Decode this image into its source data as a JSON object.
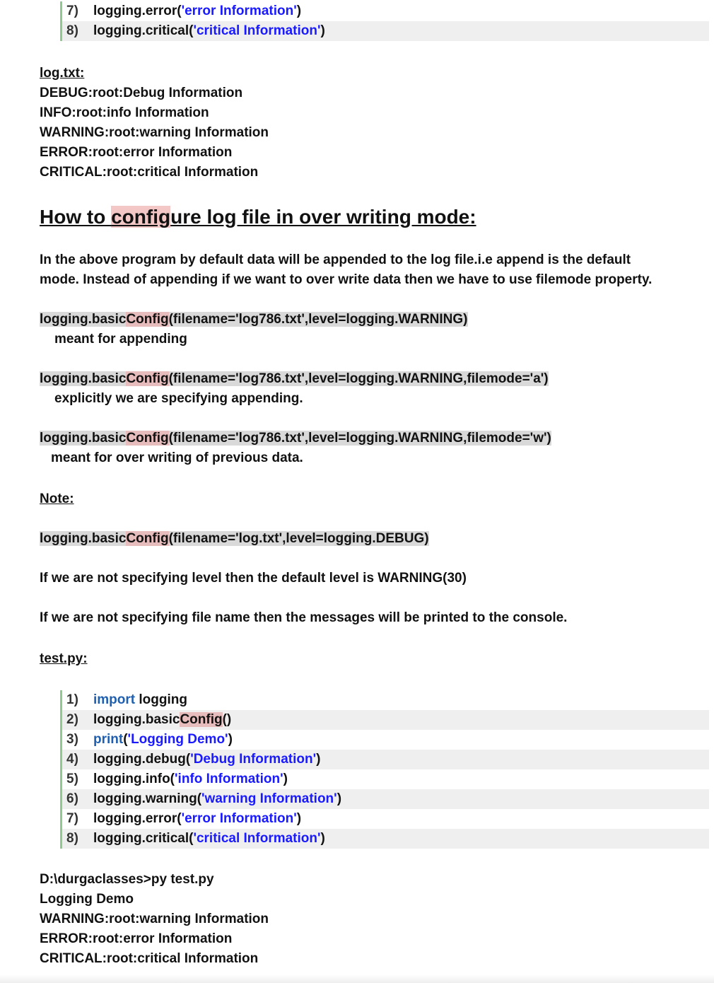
{
  "top_code": [
    {
      "num": "7)",
      "pre": "logging.error(",
      "str": "'error Information'",
      "post": ")"
    },
    {
      "num": "8)",
      "pre": "logging.critical(",
      "str": "'critical Information'",
      "post": ")"
    }
  ],
  "logtxt": {
    "title": "log.txt:",
    "lines": [
      "DEBUG:root:Debug Information",
      "INFO:root:info Information",
      "WARNING:root:warning Information",
      "ERROR:root:error Information",
      "CRITICAL:root:critical Information"
    ]
  },
  "heading": {
    "pre": "How to ",
    "mark": "config",
    "post": "ure log file in over writing mode:"
  },
  "para1": {
    "line1": "In the above program by default data will be appended to the log file.i.e append is the default",
    "line2": "mode. Instead of appending if we want to over write data then we have to use filemode property."
  },
  "examples": [
    {
      "pre": "logging.basic",
      "cfg": "Config",
      "post": "(filename='log786.txt',level=logging.WARNING)",
      "desc": "meant for appending"
    },
    {
      "pre": "logging.basic",
      "cfg": "Config",
      "post": "(filename='log786.txt',level=logging.WARNING,filemode='a')",
      "desc": "explicitly we are specifying appending."
    },
    {
      "pre": "logging.basic",
      "cfg": "Config",
      "post": "(filename='log786.txt',level=logging.WARNING,filemode='w')",
      "desc": "meant for over writing of previous data."
    }
  ],
  "note": {
    "title": "Note:",
    "code_pre": "logging.basic",
    "code_cfg": "Config",
    "code_post": "(filename='log.txt',level=logging.DEBUG)",
    "line1": "If we are not specifying level then the default level is WARNING(30)",
    "line2": "If we are not specifying file name then the messages will be printed to the console."
  },
  "testpy": {
    "title": "test.py:",
    "l1": {
      "num": "1)",
      "kw": "import",
      "rest": " logging"
    },
    "l2": {
      "num": "2)",
      "pre": "logging.basic",
      "cfg": "Config",
      "post": "()"
    },
    "l3": {
      "num": "3)",
      "kw": "print",
      "pre": "(",
      "str": "'Logging Demo'",
      "post": ")"
    },
    "l4": {
      "num": "4)",
      "pre": "logging.debug(",
      "str": "'Debug Information'",
      "post": ")"
    },
    "l5": {
      "num": "5)",
      "pre": "logging.info(",
      "str": "'info Information'",
      "post": ")"
    },
    "l6": {
      "num": "6)",
      "pre": "logging.warning(",
      "str": "'warning Information'",
      "post": ")"
    },
    "l7": {
      "num": "7)",
      "pre": "logging.error(",
      "str": "'error Information'",
      "post": ")"
    },
    "l8": {
      "num": "8)",
      "pre": "logging.critical(",
      "str": "'critical Information'",
      "post": ")"
    }
  },
  "output": [
    "D:\\durgaclasses>py test.py",
    "Logging Demo",
    "WARNING:root:warning Information",
    "ERROR:root:error Information",
    "CRITICAL:root:critical Information"
  ],
  "colors": {
    "keyword": "#1f5fb0",
    "string": "#1a1aff",
    "config_highlight": "#e7bcbc",
    "code_highlight": "#d9d9d9",
    "gutter_border": "#8fc98f"
  }
}
